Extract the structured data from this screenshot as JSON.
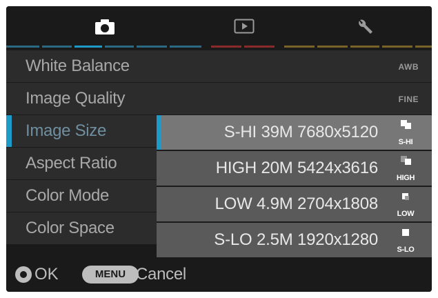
{
  "tabs": [
    {
      "name": "shooting",
      "icon": "camera-icon"
    },
    {
      "name": "playback",
      "icon": "playback-icon"
    },
    {
      "name": "setup",
      "icon": "wrench-icon"
    }
  ],
  "colors": {
    "accent": "#1d9ac8",
    "playback_tab": "#8a2b2b",
    "setup_tab": "#7a6326"
  },
  "menu": {
    "items": [
      {
        "label": "White Balance",
        "value": "AWB"
      },
      {
        "label": "Image Quality",
        "value": "FINE"
      },
      {
        "label": "Image Size",
        "value": ""
      },
      {
        "label": "Aspect Ratio",
        "value": ""
      },
      {
        "label": "Color Mode",
        "value": ""
      },
      {
        "label": "Color Space",
        "value": ""
      }
    ],
    "selected_index": 2
  },
  "dropdown": {
    "options": [
      {
        "text": "S-HI 39M 7680x5120",
        "icon_label": "S-HI",
        "selected": true
      },
      {
        "text": "HIGH 20M 5424x3616",
        "icon_label": "HIGH",
        "selected": false
      },
      {
        "text": "LOW 4.9M 2704x1808",
        "icon_label": "LOW",
        "selected": false
      },
      {
        "text": "S-LO 2.5M 1920x1280",
        "icon_label": "S-LO",
        "selected": false
      }
    ]
  },
  "footer": {
    "ok_label": "OK",
    "menu_key": "MENU",
    "cancel_label": "Cancel"
  }
}
